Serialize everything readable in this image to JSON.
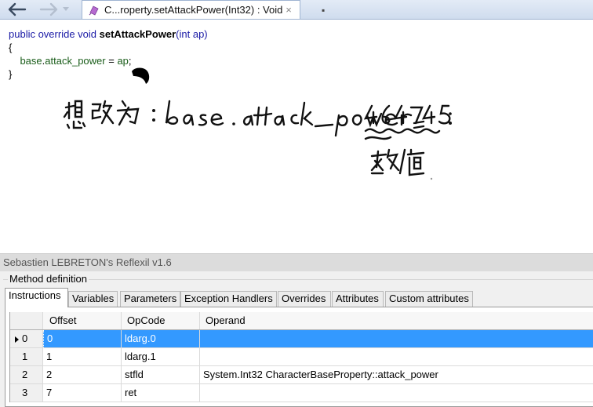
{
  "tab": {
    "title": "C...roperty.setAttackPower(Int32) : Void",
    "close": "×"
  },
  "code": {
    "line1": {
      "kw": "public override void ",
      "method": "setAttackPower",
      "params": "(int ap)"
    },
    "line2": "{",
    "line3": {
      "base": "base",
      "dot": ".",
      "field": "attack_power",
      "assign": " = ",
      "arg": "ap",
      "end": ";"
    },
    "line4": "}"
  },
  "annotation": {
    "handwritten_text": "想改为：base.attack_power = 464745;",
    "handwritten_note": "数值"
  },
  "panel": {
    "title": "Sebastien LEBRETON's Reflexil v1.6",
    "group": "Method definition",
    "tabs": [
      "Instructions",
      "Variables",
      "Parameters",
      "Exception Handlers",
      "Overrides",
      "Attributes",
      "Custom attributes"
    ],
    "active_tab": "Instructions"
  },
  "grid": {
    "headers": [
      "",
      "Offset",
      "OpCode",
      "Operand"
    ],
    "rows": [
      {
        "index": "0",
        "offset": "0",
        "opcode": "ldarg.0",
        "operand": "",
        "selected": true
      },
      {
        "index": "1",
        "offset": "1",
        "opcode": "ldarg.1",
        "operand": ""
      },
      {
        "index": "2",
        "offset": "2",
        "opcode": "stfld",
        "operand": "System.Int32 CharacterBaseProperty::attack_power"
      },
      {
        "index": "3",
        "offset": "7",
        "opcode": "ret",
        "operand": ""
      }
    ]
  },
  "colors": {
    "selection": "#3399ff",
    "keyword": "#1a1aa6",
    "field": "#1a5d1a"
  }
}
